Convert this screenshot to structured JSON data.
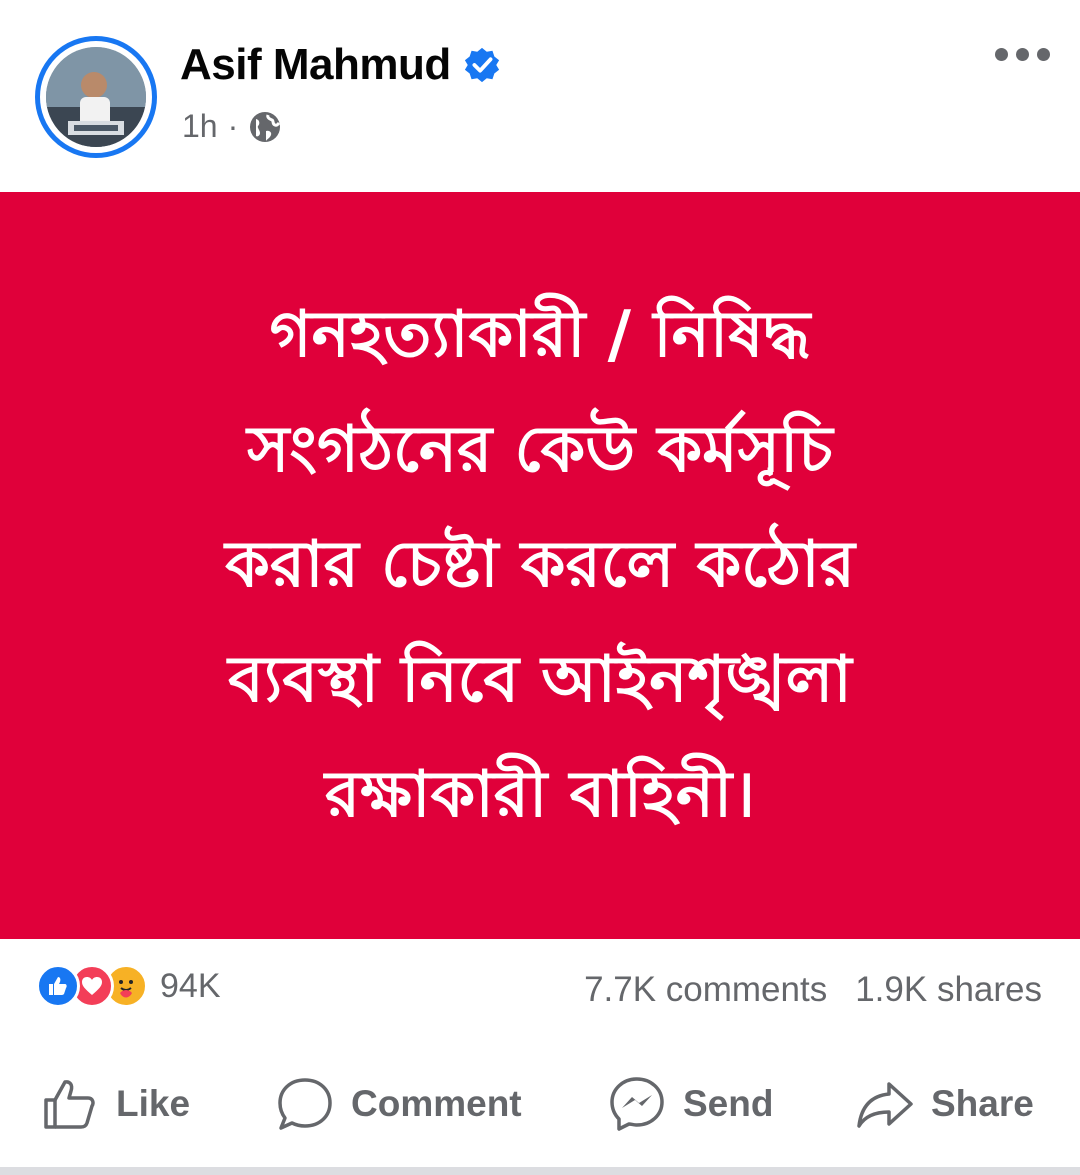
{
  "post": {
    "author": "Asif Mahmud",
    "time": "1h",
    "separator": "·",
    "privacy_icon": "globe-icon",
    "verified_icon": "verified-badge-icon"
  },
  "banner": {
    "color": "#e0003a",
    "lines": [
      "গনহত্যাকারী / নিষিদ্ধ",
      "সংগঠনের কেউ কর্মসূচি",
      "করার চেষ্টা করলে কঠোর",
      "ব্যবস্থা নিবে আইনশৃঙ্খলা",
      "রক্ষাকারী বাহিনী।"
    ]
  },
  "stats": {
    "reaction_count": "94K",
    "comments": "7.7K comments",
    "shares": "1.9K shares",
    "reactions": [
      "like-icon",
      "love-icon",
      "care-icon"
    ]
  },
  "actions": {
    "like": "Like",
    "comment": "Comment",
    "send": "Send",
    "share": "Share"
  },
  "colors": {
    "accent": "#1877f2",
    "secondary_text": "#65676b"
  }
}
